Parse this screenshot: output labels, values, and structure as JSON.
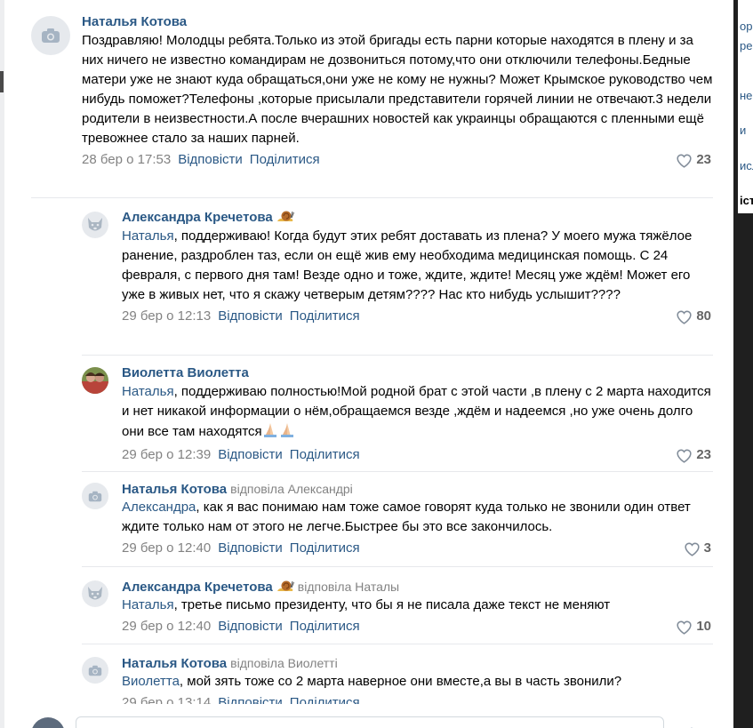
{
  "sidebar_right_fragments": [
    "ороге",
    "рей",
    "нерг",
    "и",
    "исл",
    "істі"
  ],
  "comments": [
    {
      "author": "Наталья Котова",
      "text": "Поздравляю! Молодцы ребята.Только из этой бригады есть парни которые находятся в плену и за них ничего не известно командирам не дозвониться потому,что они отключили телефоны.Бедные матери уже не знают куда обращаться,они уже не кому не нужны? Может Крымское руководство чем нибудь поможет?Телефоны ,которые присылали представители горячей линии не отвечают.3 недели родители в неизвестности.А после вчерашних новостей как украинцы обращаются с пленными ещё тревожнее стало за наших парней.",
      "date": "28 бер о 17:53",
      "reply": "Відповісти",
      "share": "Поділитися",
      "likes": "23"
    },
    {
      "author": "Александра Кречетова",
      "mention": "Наталья",
      "text": ", поддерживаю! Когда будут этих ребят доставать из плена? У моего мужа тяжёлое ранение, раздроблен таз, если он ещё жив ему необходима медицинская помощь. С 24 февраля, с первого дня там! Везде одно и тоже, ждите, ждите! Месяц уже ждём! Может его уже в живых нет, что я скажу четверым детям???? Нас кто нибудь услышит????",
      "date": "29 бер о 12:13",
      "reply": "Відповісти",
      "share": "Поділитися",
      "likes": "80"
    },
    {
      "author": "Виолетта Виолетта",
      "mention": "Наталья",
      "text": ", поддерживаю полностью!Мой родной брат с этой части ,в плену с 2 марта находится и нет никакой информации о нём,обращаемся везде ,ждём и надеемся ,но уже очень долго они все там находятся",
      "date": "29 бер о 12:39",
      "reply": "Відповісти",
      "share": "Поділитися",
      "likes": "23"
    },
    {
      "author": "Наталья Котова",
      "replied_to": "відповіла Александрі",
      "mention": "Александра",
      "text": ", как я вас понимаю нам тоже самое говорят куда только не звонили один ответ ждите только нам от этого не легче.Быстрее бы это все закончилось.",
      "date": "29 бер о 12:40",
      "reply": "Відповісти",
      "share": "Поділитися",
      "likes": "3"
    },
    {
      "author": "Александра Кречетова",
      "replied_to": "відповіла Наталы",
      "mention": "Наталья",
      "text": ", третье письмо президенту, что бы я не писала даже текст не меняют",
      "date": "29 бер о 12:40",
      "reply": "Відповісти",
      "share": "Поділитися",
      "likes": "10"
    },
    {
      "author": "Наталья Котова",
      "replied_to": "відповіла Виолетті",
      "mention": "Виолетта",
      "text": ", мой зять тоже со 2 марта наверное они вместе,а вы в часть звонили?",
      "date": "29 бер о 13:14",
      "reply": "Відповісти",
      "share": "Поділитися"
    }
  ],
  "icons": {
    "camera": "camera-placeholder-icon",
    "dog": "vk-dog-avatar-icon",
    "snail": "snail-emoji-icon",
    "pray": "folded-hands-emoji-icon",
    "heart": "heart-outline-icon"
  },
  "colors": {
    "link": "#2a5885",
    "meta": "#828282",
    "like": "#656565"
  }
}
